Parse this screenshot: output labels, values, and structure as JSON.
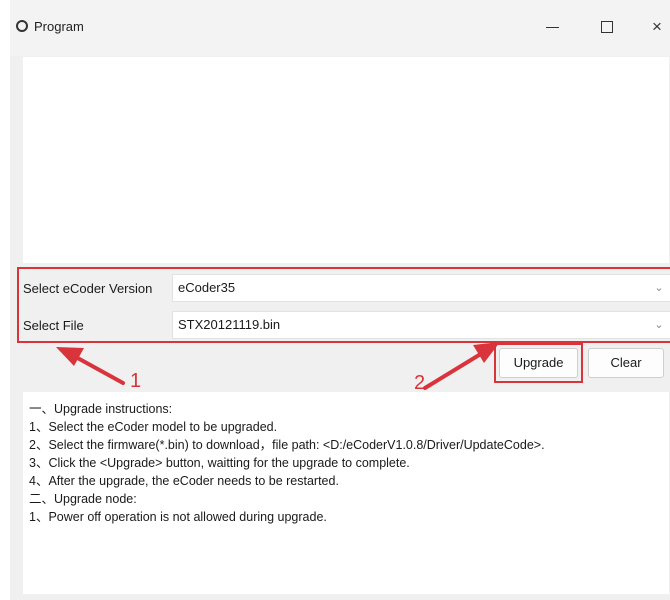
{
  "window": {
    "title": "Program",
    "controls": {
      "minimize": "minimize-icon",
      "maximize": "maximize-icon",
      "close": "×"
    }
  },
  "params": {
    "version_label": "Select eCoder Version",
    "version_value": "eCoder35",
    "file_label": "Select File",
    "file_value": "STX20121119.bin"
  },
  "buttons": {
    "upgrade": "Upgrade",
    "clear": "Clear"
  },
  "annotations": {
    "step1": "1",
    "step2": "2",
    "color": "#d9333b"
  },
  "log": [
    "一、Upgrade instructions:",
    "1、Select the eCoder model to be upgraded.",
    "2、Select the firmware(*.bin) to download，file path: <D:/eCoderV1.0.8/Driver/UpdateCode>.",
    "3、Click the <Upgrade> button, waitting for the upgrade to complete.",
    "4、After the upgrade, the eCoder needs to be restarted.",
    "二、Upgrade node:",
    "1、Power off operation is not allowed during upgrade."
  ]
}
